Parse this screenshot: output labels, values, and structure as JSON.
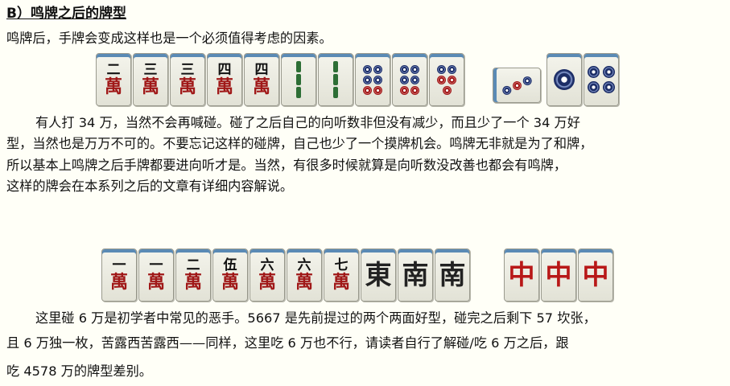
{
  "section": {
    "heading": "B）鸣牌之后的牌型"
  },
  "intro": "鸣牌后，手牌会变成这样也是一个必须值得考虑的因素。",
  "hand1": {
    "tiles": [
      {
        "num": "二",
        "man": "萬"
      },
      {
        "num": "三",
        "man": "萬"
      },
      {
        "num": "三",
        "man": "萬"
      },
      {
        "num": "四",
        "man": "萬"
      },
      {
        "num": "四",
        "man": "萬"
      }
    ],
    "sou": [
      "2-sou",
      "2-sou"
    ],
    "pin": [
      "8-pin",
      "8-pin"
    ],
    "pin2": [
      "7-pin"
    ],
    "called": [
      "3-pin sideways",
      "1-pin",
      "4-pin"
    ]
  },
  "para1": {
    "lines": [
      "有人打 34 万，当然不会再喊碰。碰了之后自己的向听数非但没有减少，而且少了一个 34 万好",
      "型，当然也是万万不可的。不要忘记这样的碰牌，自己也少了一个摸牌机会。鸣牌无非就是为了和牌，",
      "所以基本上鸣牌之后手牌都要进向听才是。当然，有很多时候就算是向听数没改善也都会有鸣牌，",
      "这样的牌会在本系列之后的文章有详细内容解说。"
    ]
  },
  "hand2": {
    "tiles": [
      {
        "num": "一",
        "man": "萬"
      },
      {
        "num": "一",
        "man": "萬"
      },
      {
        "num": "二",
        "man": "萬"
      },
      {
        "num": "伍",
        "man": "萬"
      },
      {
        "num": "六",
        "man": "萬"
      },
      {
        "num": "六",
        "man": "萬"
      },
      {
        "num": "七",
        "man": "萬"
      }
    ],
    "honors": [
      "東",
      "南",
      "南"
    ],
    "chun": [
      "中",
      "中",
      "中"
    ]
  },
  "para2": {
    "lines": [
      "这里碰 6 万是初学者中常见的恶手。5667 是先前提过的两个两面好型，碰完之后剩下 57 坎张，",
      "且 6 万独一枚，苦露西苦露西——同样，这里吃 6 万也不行，请读者自行了解碰/吃 6 万之后，跟",
      "吃 4578 万的牌型差别。"
    ]
  }
}
